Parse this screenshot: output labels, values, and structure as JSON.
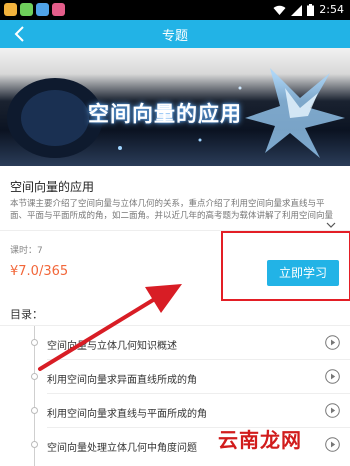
{
  "status_bar": {
    "time": "2:54",
    "icons": [
      "app-icon-1",
      "app-icon-2",
      "app-icon-3",
      "app-icon-4",
      "wifi-icon",
      "signal-icon",
      "battery-icon"
    ]
  },
  "app_bar": {
    "title": "专题",
    "back_icon": "back-chevron-icon"
  },
  "banner": {
    "title": "空间向量的应用"
  },
  "course": {
    "title": "空间向量的应用",
    "description": "本节课主要介绍了空间向量与立体几何的关系，重点介绍了利用空间向量求直线与平面、平面与平面所成的角，如二面角。并以近几年的高考题为载体讲解了利用空间向量",
    "lessons": "课时：7",
    "price": "¥7.0/365",
    "learn_button": "立即学习"
  },
  "directory": {
    "label": "目录：",
    "items": [
      "空间向量与立体几何知识概述",
      "利用空间向量求异面直线所成的角",
      "利用空间向量求直线与平面所成的角",
      "空间向量处理立体几何中角度问题"
    ]
  },
  "annotation": {
    "highlight_color": "#e31e25"
  },
  "watermark": "云南龙网",
  "colors": {
    "accent": "#22b3e6",
    "price": "#f2673a"
  }
}
